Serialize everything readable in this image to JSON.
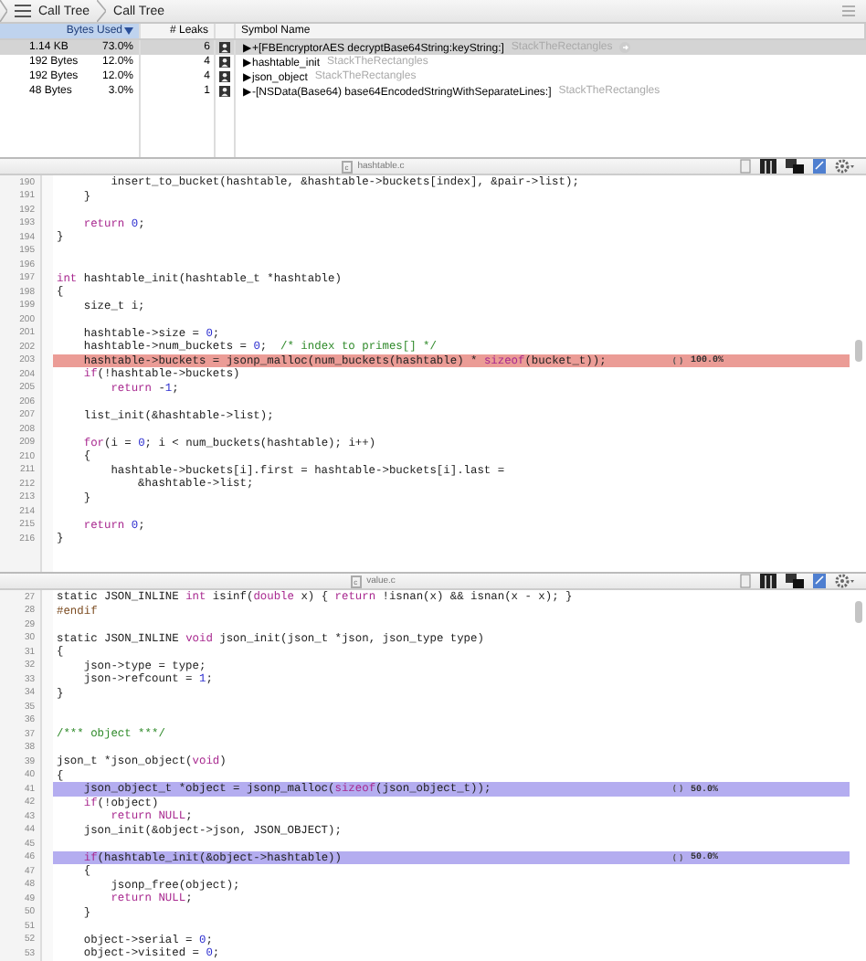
{
  "breadcrumbs": [
    "Call Tree",
    "Call Tree"
  ],
  "table": {
    "columns": [
      {
        "label": "Bytes Used",
        "selected": true
      },
      {
        "label": "# Leaks",
        "selected": false
      },
      {
        "label": "Symbol Name",
        "selected": false
      }
    ],
    "rows": [
      {
        "bytes": "1.14 KB",
        "percent": "73.0%",
        "leaks": "6",
        "symbol": "▶+[FBEncryptorAES decryptBase64String:keyString:]",
        "library": "StackTheRectangles",
        "selected": true
      },
      {
        "bytes": "192 Bytes",
        "percent": "12.0%",
        "leaks": "4",
        "symbol": "▶hashtable_init",
        "library": "StackTheRectangles",
        "selected": false
      },
      {
        "bytes": "192 Bytes",
        "percent": "12.0%",
        "leaks": "4",
        "symbol": "▶json_object",
        "library": "StackTheRectangles",
        "selected": false
      },
      {
        "bytes": "48 Bytes",
        "percent": "3.0%",
        "leaks": "1",
        "symbol": "▶-[NSData(Base64) base64EncodedStringWithSeparateLines:]",
        "library": "StackTheRectangles",
        "selected": false
      }
    ]
  },
  "editors": [
    {
      "file_badge": "c",
      "file": "hashtable.c",
      "lines": [
        {
          "n": "190",
          "code": [
            {
              "text": "        insert_to_bucket(hashtable, &hashtable->buckets[index], &pair->list);"
            }
          ]
        },
        {
          "n": "191",
          "code": [
            {
              "text": "    }"
            }
          ]
        },
        {
          "n": "192"
        },
        {
          "n": "193",
          "code": [
            {
              "text": "    return",
              "kind": "keyword"
            },
            {
              "text": " 0",
              "kind": "number"
            },
            {
              "text": ";"
            }
          ]
        },
        {
          "n": "194",
          "code": [
            {
              "text": "}"
            }
          ]
        },
        {
          "n": "195"
        },
        {
          "n": "196"
        },
        {
          "n": "197",
          "code": [
            {
              "text": "int",
              "kind": "keyword"
            },
            {
              "text": " hashtable_init(hashtable_t *hashtable)"
            }
          ]
        },
        {
          "n": "198",
          "code": [
            {
              "text": "{"
            }
          ]
        },
        {
          "n": "199",
          "code": [
            {
              "text": "    size_t i;"
            }
          ]
        },
        {
          "n": "200"
        },
        {
          "n": "201",
          "code": [
            {
              "text": "    hashtable->size = "
            },
            {
              "text": "0",
              "kind": "number"
            },
            {
              "text": ";"
            }
          ]
        },
        {
          "n": "202",
          "code": [
            {
              "text": "    hashtable->num_buckets = "
            },
            {
              "text": "0",
              "kind": "number"
            },
            {
              "text": ";  "
            },
            {
              "text": "/* index to primes[] */",
              "kind": "comment"
            }
          ]
        },
        {
          "n": "203",
          "code": [
            {
              "text": "    hashtable->buckets = jsonp_malloc(num_buckets(hashtable) * "
            },
            {
              "text": "sizeof",
              "kind": "keyword"
            },
            {
              "text": "(bucket_t));"
            }
          ],
          "color": "#eb9c96",
          "percent": "100.0%"
        },
        {
          "n": "204",
          "code": [
            {
              "text": "    if",
              "kind": "keyword"
            },
            {
              "text": "(!hashtable->buckets)"
            }
          ]
        },
        {
          "n": "205",
          "code": [
            {
              "text": "        return",
              "kind": "keyword"
            },
            {
              "text": " -"
            },
            {
              "text": "1",
              "kind": "number"
            },
            {
              "text": ";"
            }
          ]
        },
        {
          "n": "206"
        },
        {
          "n": "207",
          "code": [
            {
              "text": "    list_init(&hashtable->list);"
            }
          ]
        },
        {
          "n": "208"
        },
        {
          "n": "209",
          "code": [
            {
              "text": "    for",
              "kind": "keyword"
            },
            {
              "text": "(i = "
            },
            {
              "text": "0",
              "kind": "number"
            },
            {
              "text": "; i < num_buckets(hashtable); i++)"
            }
          ]
        },
        {
          "n": "210",
          "code": [
            {
              "text": "    {"
            }
          ]
        },
        {
          "n": "211",
          "code": [
            {
              "text": "        hashtable->buckets[i].first = hashtable->buckets[i].last ="
            }
          ]
        },
        {
          "n": "212",
          "code": [
            {
              "text": "            &hashtable->list;"
            }
          ]
        },
        {
          "n": "213",
          "code": [
            {
              "text": "    }"
            }
          ]
        },
        {
          "n": "214"
        },
        {
          "n": "215",
          "code": [
            {
              "text": "    return",
              "kind": "keyword"
            },
            {
              "text": " 0",
              "kind": "number"
            },
            {
              "text": ";"
            }
          ]
        },
        {
          "n": "216",
          "code": [
            {
              "text": "}"
            }
          ]
        }
      ]
    },
    {
      "file_badge": "c",
      "file": "value.c",
      "lines": [
        {
          "n": "27",
          "code": [
            {
              "text": "static JSON_INLINE "
            },
            {
              "text": "int",
              "kind": "keyword"
            },
            {
              "text": " isinf("
            },
            {
              "text": "double",
              "kind": "keyword"
            },
            {
              "text": " x) { "
            },
            {
              "text": "return",
              "kind": "keyword"
            },
            {
              "text": " !isnan(x) && isnan(x - x); }"
            }
          ]
        },
        {
          "n": "28",
          "code": [
            {
              "text": "#endif",
              "kind": "preprocessor"
            }
          ]
        },
        {
          "n": "29"
        },
        {
          "n": "30",
          "code": [
            {
              "text": "static JSON_INLINE "
            },
            {
              "text": "void",
              "kind": "keyword"
            },
            {
              "text": " json_init(json_t *json, json_type type)"
            }
          ]
        },
        {
          "n": "31",
          "code": [
            {
              "text": "{"
            }
          ]
        },
        {
          "n": "32",
          "code": [
            {
              "text": "    json->type = type;"
            }
          ]
        },
        {
          "n": "33",
          "code": [
            {
              "text": "    json->refcount = "
            },
            {
              "text": "1",
              "kind": "number"
            },
            {
              "text": ";"
            }
          ]
        },
        {
          "n": "34",
          "code": [
            {
              "text": "}"
            }
          ]
        },
        {
          "n": "35"
        },
        {
          "n": "36"
        },
        {
          "n": "37",
          "code": [
            {
              "text": "/*** object ***/",
              "kind": "comment"
            }
          ]
        },
        {
          "n": "38"
        },
        {
          "n": "39",
          "code": [
            {
              "text": "json_t *json_object("
            },
            {
              "text": "void",
              "kind": "keyword"
            },
            {
              "text": ")"
            }
          ]
        },
        {
          "n": "40",
          "code": [
            {
              "text": "{"
            }
          ]
        },
        {
          "n": "41",
          "code": [
            {
              "text": "    json_object_t *object = jsonp_malloc("
            },
            {
              "text": "sizeof",
              "kind": "keyword"
            },
            {
              "text": "(json_object_t));"
            }
          ],
          "color": "#b4adf0",
          "percent": "50.0%"
        },
        {
          "n": "42",
          "code": [
            {
              "text": "    if",
              "kind": "keyword"
            },
            {
              "text": "(!object)"
            }
          ]
        },
        {
          "n": "43",
          "code": [
            {
              "text": "        return NULL",
              "kind": "keyword"
            },
            {
              "text": ";"
            }
          ]
        },
        {
          "n": "44",
          "code": [
            {
              "text": "    json_init(&object->json, JSON_OBJECT);"
            }
          ]
        },
        {
          "n": "45"
        },
        {
          "n": "46",
          "code": [
            {
              "text": "    if",
              "kind": "keyword"
            },
            {
              "text": "(hashtable_init(&object->hashtable))"
            }
          ],
          "color": "#b4adf0",
          "percent": "50.0%"
        },
        {
          "n": "47",
          "code": [
            {
              "text": "    {"
            }
          ]
        },
        {
          "n": "48",
          "code": [
            {
              "text": "        jsonp_free(object);"
            }
          ]
        },
        {
          "n": "49",
          "code": [
            {
              "text": "        return NULL",
              "kind": "keyword"
            },
            {
              "text": ";"
            }
          ]
        },
        {
          "n": "50",
          "code": [
            {
              "text": "    }"
            }
          ]
        },
        {
          "n": "51"
        },
        {
          "n": "52",
          "code": [
            {
              "text": "    object->serial = "
            },
            {
              "text": "0",
              "kind": "number"
            },
            {
              "text": ";"
            }
          ]
        },
        {
          "n": "53",
          "code": [
            {
              "text": "    object->visited = "
            },
            {
              "text": "0",
              "kind": "number"
            },
            {
              "text": ";"
            }
          ]
        }
      ]
    }
  ]
}
